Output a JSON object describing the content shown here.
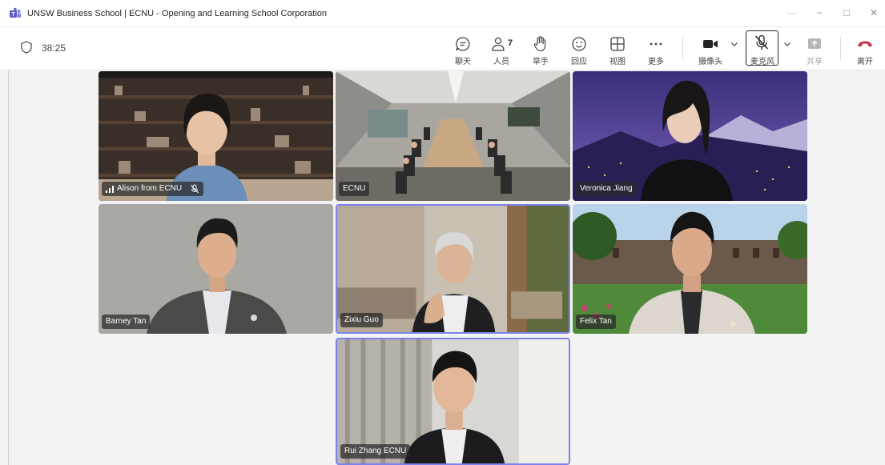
{
  "window": {
    "title": "UNSW Business School | ECNU - Opening and Learning School Corporation",
    "controls": [
      "···",
      "−",
      "□",
      "✕"
    ]
  },
  "meeting": {
    "timer": "38:25"
  },
  "toolbar": {
    "chat": "聊天",
    "people": "人员",
    "people_count": "7",
    "raise_hand": "举手",
    "react": "回应",
    "view": "视图",
    "more": "更多",
    "camera": "摄像头",
    "mic": "麦克风",
    "share": "共享",
    "leave": "离开"
  },
  "participants": [
    {
      "name": "Alison from ECNU",
      "muted": true
    },
    {
      "name": "ECNU"
    },
    {
      "name": "Veronica Jiang"
    },
    {
      "name": "Barney Tan"
    },
    {
      "name": "Zixiu Guo",
      "speaking": true
    },
    {
      "name": "Felix Tan"
    },
    {
      "name": "Rui Zhang ECNU",
      "speaking": true
    }
  ],
  "colors": {
    "accent": "#7b83eb",
    "leave": "#c4314b",
    "teams_purple": "#5b5fc7"
  }
}
